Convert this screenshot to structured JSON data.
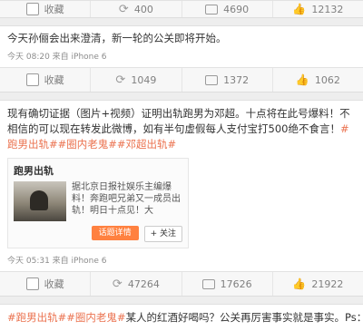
{
  "top_actions": {
    "favorite": "收藏",
    "repost_count": "400",
    "comment_count": "4690",
    "like_count": "12132"
  },
  "post1": {
    "text": "今天孙俪会出来澄清，新一轮的公关即将开始。",
    "meta": "今天 08:20 来自 iPhone 6",
    "actions": {
      "favorite": "收藏",
      "repost_count": "1049",
      "comment_count": "1372",
      "like_count": "1062"
    }
  },
  "post2": {
    "text_plain": "现有确切证据（图片+视频）证明出轨跑男为邓超。十点将在此号爆料！不相信的可以现在转发此微博，如有半句虚假每人支付宝打500绝不食言！",
    "hashtags": [
      "#跑男出轨#",
      "#圈内老鬼#",
      "#邓超出轨#"
    ],
    "card": {
      "title": "跑男出轨",
      "desc": "据北京日报社娱乐主编爆料！奔跑吧兄弟又一成员出轨！明日十点见！大",
      "btn_detail": "话题详情",
      "btn_follow": "+ 关注"
    },
    "meta": "今天 05:31 来自 iPhone 6",
    "actions": {
      "favorite": "收藏",
      "repost_count": "47264",
      "comment_count": "17626",
      "like_count": "21922"
    }
  },
  "post3": {
    "hashtags": [
      "#跑男出轨#",
      "#圈内老鬼#"
    ],
    "text": "某人的红酒好喝吗？公关再厉害事实就是事实。Ps：好像冒出很多"
  }
}
